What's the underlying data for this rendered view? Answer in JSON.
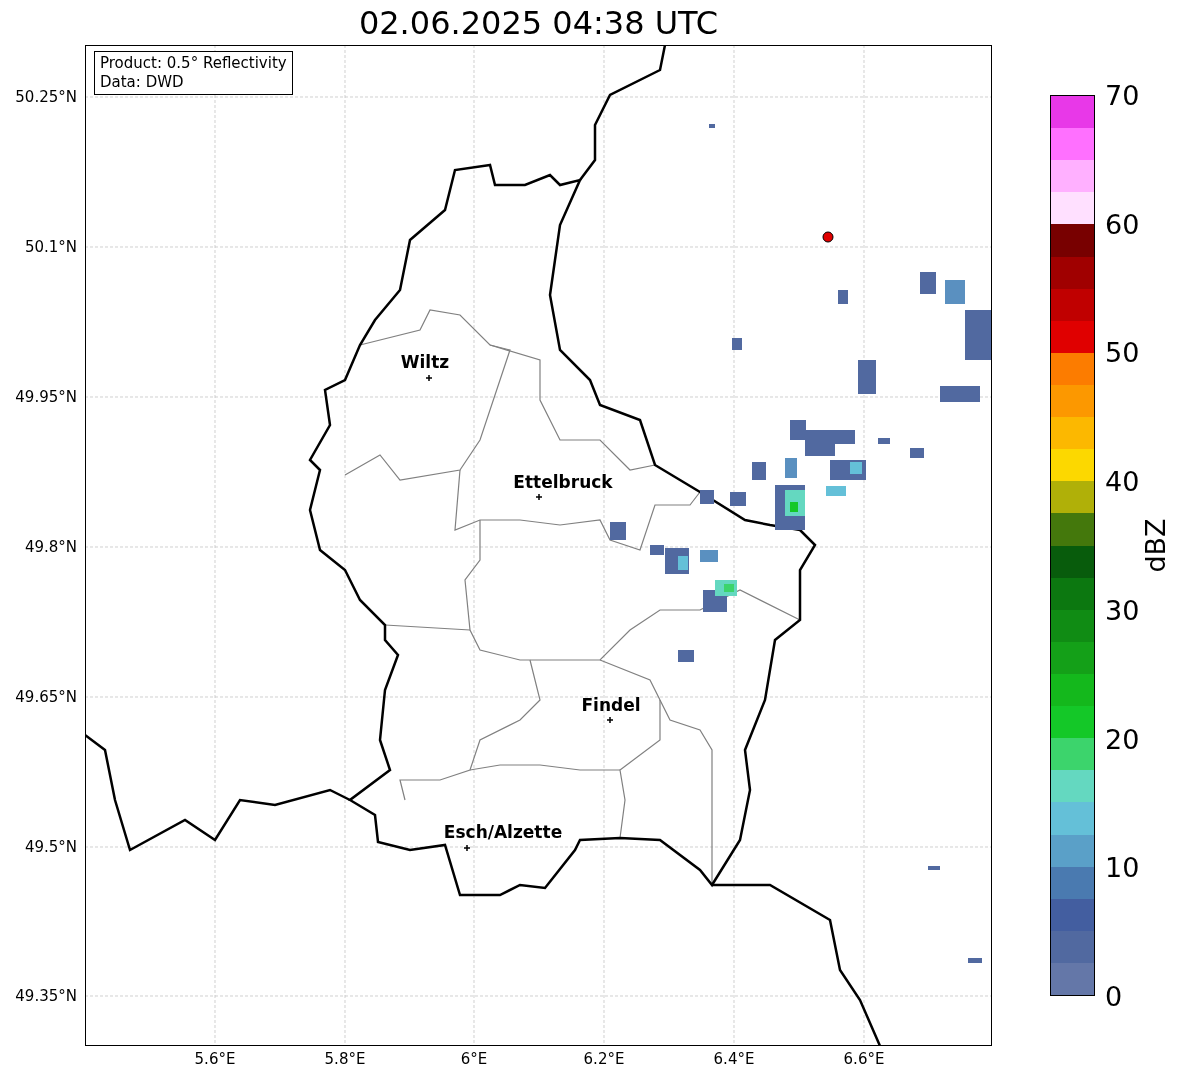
{
  "title": "02.06.2025 04:38 UTC",
  "legend": {
    "lines": [
      "Product: 0.5° Reflectivity",
      "Data: DWD"
    ]
  },
  "y_ticks": [
    "50.25°N",
    "50.1°N",
    "49.95°N",
    "49.8°N",
    "49.65°N",
    "49.5°N",
    "49.35°N"
  ],
  "x_ticks": [
    "5.6°E",
    "5.8°E",
    "6°E",
    "6.2°E",
    "6.4°E",
    "6.6°E"
  ],
  "places": [
    {
      "name": "Wiltz"
    },
    {
      "name": "Ettelbruck"
    },
    {
      "name": "Findel"
    },
    {
      "name": "Esch/Alzette"
    }
  ],
  "colorbar": {
    "label": "dBZ",
    "ticks": [
      "70",
      "60",
      "50",
      "40",
      "30",
      "20",
      "10",
      "0"
    ],
    "bands": [
      {
        "color": "#e838e8"
      },
      {
        "color": "#ff70ff"
      },
      {
        "color": "#ffb0ff"
      },
      {
        "color": "#ffe0ff"
      },
      {
        "color": "#780000"
      },
      {
        "color": "#a00000"
      },
      {
        "color": "#c00000"
      },
      {
        "color": "#e00000"
      },
      {
        "color": "#fc7c00"
      },
      {
        "color": "#fc9800"
      },
      {
        "color": "#fcb800"
      },
      {
        "color": "#fcd800"
      },
      {
        "color": "#b0b008"
      },
      {
        "color": "#44780c"
      },
      {
        "color": "#085c0c"
      },
      {
        "color": "#0c7810"
      },
      {
        "color": "#108c14"
      },
      {
        "color": "#14a018"
      },
      {
        "color": "#14b81c"
      },
      {
        "color": "#14c828"
      },
      {
        "color": "#3cd46c"
      },
      {
        "color": "#64d8c0"
      },
      {
        "color": "#64c0d8"
      },
      {
        "color": "#5aa0c8"
      },
      {
        "color": "#4a7ab0"
      },
      {
        "color": "#435ea0"
      },
      {
        "color": "#5169a0"
      },
      {
        "color": "#6477a8"
      }
    ]
  }
}
